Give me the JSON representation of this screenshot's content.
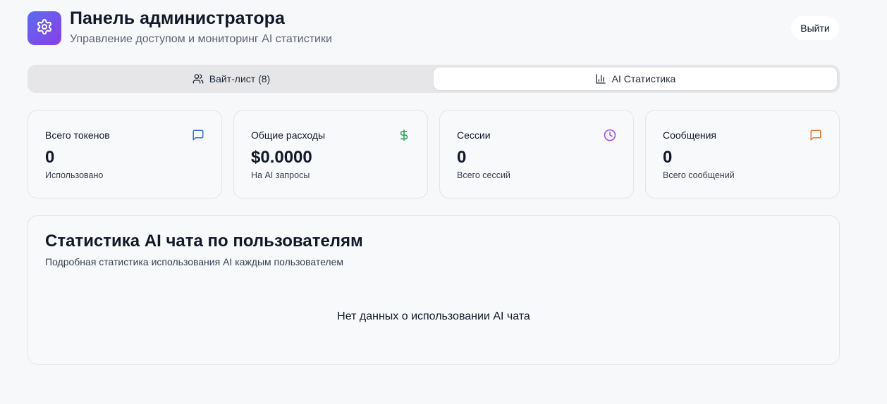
{
  "header": {
    "title": "Панель администратора",
    "subtitle": "Управление доступом и мониторинг AI статистики",
    "logo_icon": "gear-icon",
    "logout_label": "Выйти"
  },
  "tabs": [
    {
      "label": "Вайт-лист (8)",
      "icon": "users-icon",
      "active": false
    },
    {
      "label": "AI Статистика",
      "icon": "bar-chart-icon",
      "active": true
    }
  ],
  "stats": [
    {
      "title": "Всего токенов",
      "value": "0",
      "caption": "Использовано",
      "icon": "message-square-icon",
      "color": "#3b6fe0"
    },
    {
      "title": "Общие расходы",
      "value": "$0.0000",
      "caption": "На AI запросы",
      "icon": "dollar-icon",
      "color": "#22a455"
    },
    {
      "title": "Сессии",
      "value": "0",
      "caption": "Всего сессий",
      "icon": "clock-icon",
      "color": "#9b4fe0"
    },
    {
      "title": "Сообщения",
      "value": "0",
      "caption": "Всего сообщений",
      "icon": "message-square-icon",
      "color": "#e8762e"
    }
  ],
  "panel": {
    "title": "Статистика AI чата по пользователям",
    "subtitle": "Подробная статистика использования AI каждым пользователем",
    "empty_text": "Нет данных о использовании AI чата"
  },
  "colors": {
    "accent_gradient_start": "#5b6cf0",
    "accent_gradient_end": "#8a3ee6",
    "background": "#f7f8fa"
  }
}
